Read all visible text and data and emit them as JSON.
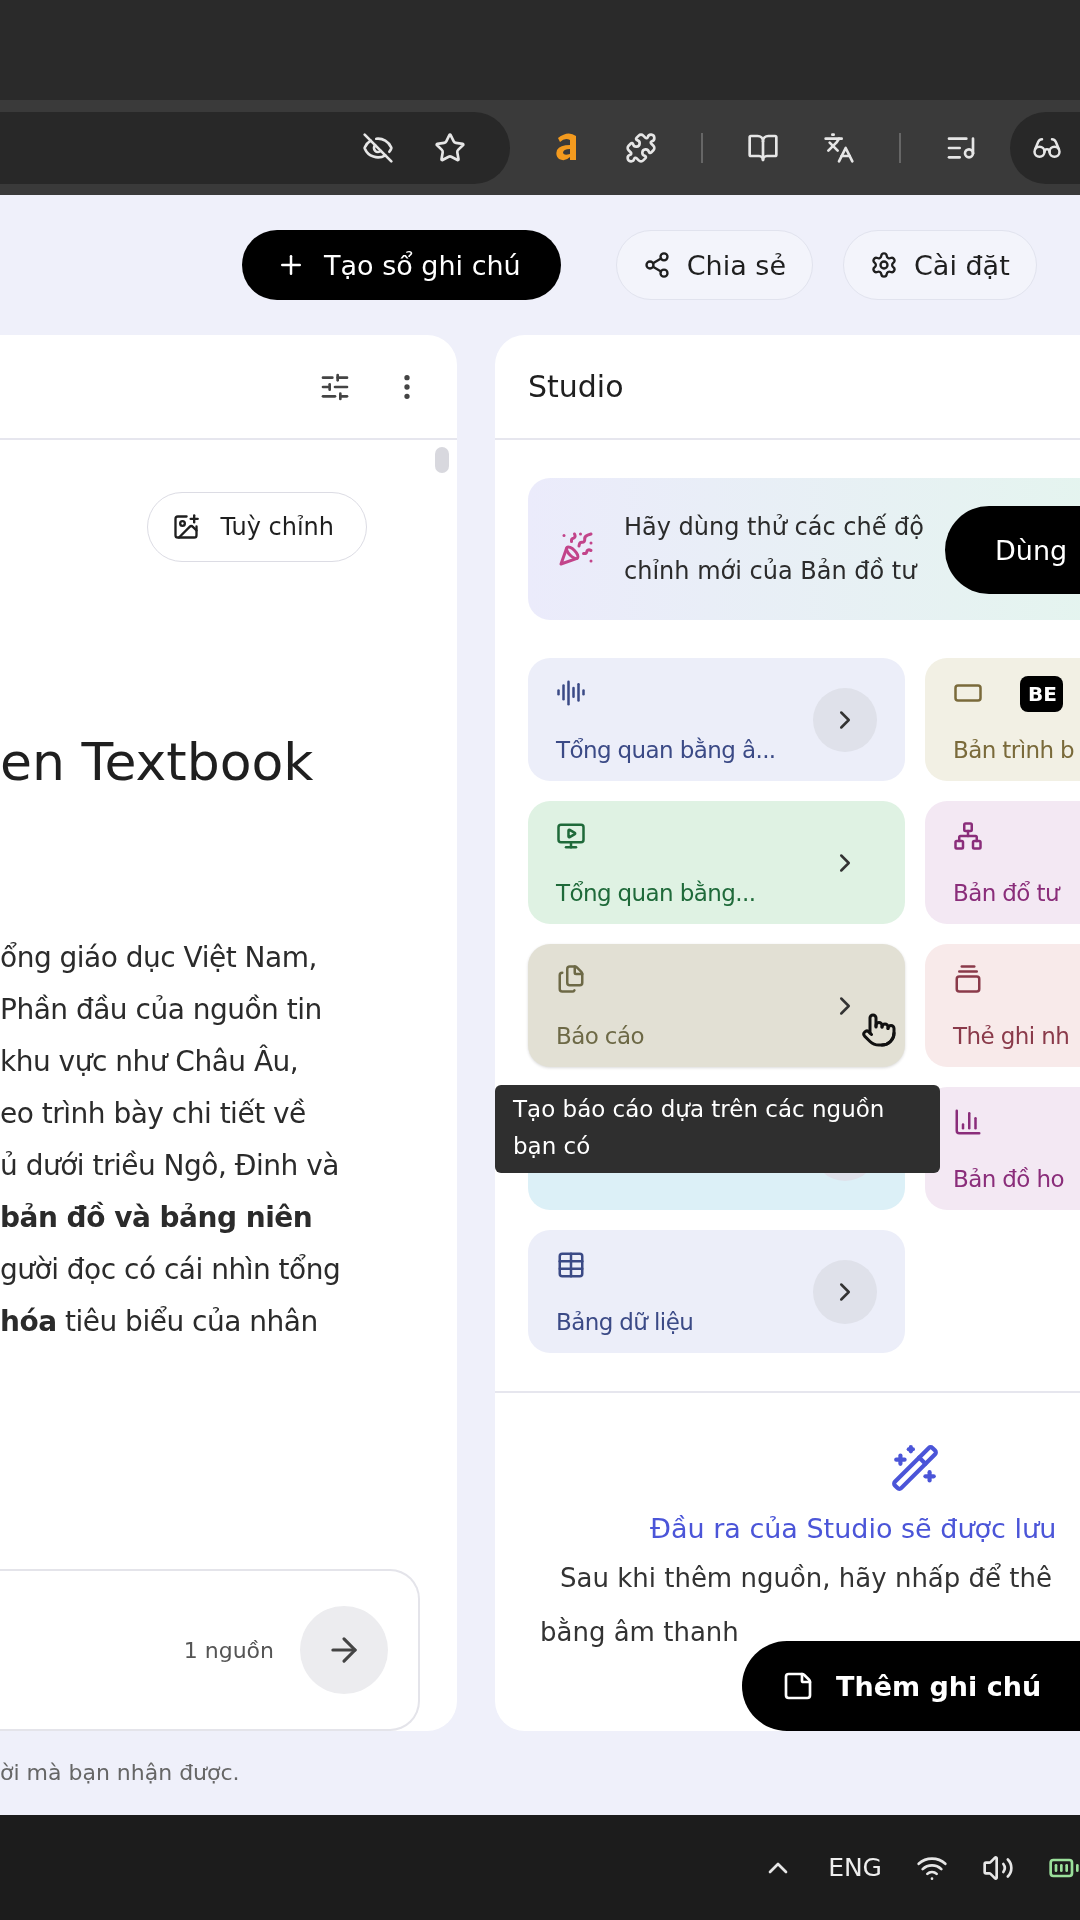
{
  "header": {
    "create_button": "Tạo sổ ghi chú",
    "share_button": "Chia sẻ",
    "settings_button": "Cài đặt"
  },
  "left_panel": {
    "customize_button": "Tuỳ chỉnh",
    "title": "en Textbook",
    "summary_lines": [
      "ổng giáo dục Việt Nam,",
      " Phần đầu của nguồn tin",
      "khu vực như Châu Âu,",
      "eo trình bày chi tiết về",
      "ủ dưới triều Ngô, Đinh và",
      "**bản đồ và bảng niên**",
      "gười đọc có cái nhìn tổng",
      "**hóa** tiêu biểu của nhân"
    ],
    "source_count": "1 nguồn",
    "footer_note": "ời mà bạn nhận được."
  },
  "studio": {
    "title": "Studio",
    "banner_lines": [
      "Hãy dùng thử các chế độ",
      "chỉnh mới của Bản đồ tư"
    ],
    "banner_button": "Dùng",
    "card_rows": [
      [
        {
          "kind": "audio",
          "label": "Tổng quan bằng â...",
          "chevron_circle": true
        },
        {
          "kind": "slides",
          "label": "Bản trình b",
          "badge": "BE"
        }
      ],
      [
        {
          "kind": "video",
          "label": "Tổng quan bằng...",
          "chevron_circle": false
        },
        {
          "kind": "mindmap",
          "label": "Bản đổ tư"
        }
      ],
      [
        {
          "kind": "report",
          "label": "Báo cáo",
          "chevron_circle": false,
          "hovered": true
        },
        {
          "kind": "flashcards",
          "label": "Thẻ ghi nh"
        }
      ],
      [
        {
          "kind": "quiz",
          "chevron_circle": true
        },
        {
          "kind": "infographic",
          "label": "Bản đồ ho"
        }
      ],
      [
        {
          "kind": "table",
          "label": "Bảng dữ liệu",
          "chevron_circle": true
        }
      ]
    ],
    "tooltip": "Tạo báo cáo dựa trên các nguồn bạn có",
    "empty_title": "Đầu ra của Studio sẽ được lưu",
    "empty_lines": [
      "Sau khi thêm nguồn, hãy nhấp để thê",
      "bằng âm thanh"
    ],
    "add_note_button": "Thêm ghi chú"
  },
  "taskbar": {
    "language": "ENG"
  }
}
